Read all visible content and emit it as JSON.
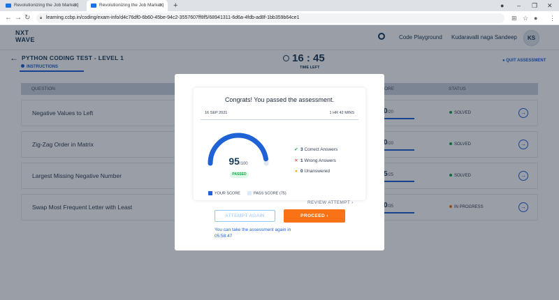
{
  "browser": {
    "tabs": [
      {
        "title": "Revolutionizing the Job Market |"
      },
      {
        "title": "Revolutionizing the Job Market |"
      }
    ],
    "new_tab": "+",
    "url": "learning.ccbp.in/coding/exam-info/d4c76df0-6b60-45be-94c2-3557607ff8f5/68941311-6d6a-4fdb-ad8f-1bb359b64ce1",
    "window_controls": {
      "minimize": "–",
      "restore": "❐",
      "close": "✕"
    }
  },
  "header": {
    "logo_line1": "NXT",
    "logo_line2": "WAVE",
    "code_playground": "Code Playground",
    "user_name": "Kudaravalli naga Sandeep",
    "avatar_initials": "KS"
  },
  "subheader": {
    "back_glyph": "←",
    "title": "PYTHON CODING TEST - LEVEL 1",
    "instructions": "INSTRUCTIONS",
    "time_value": "16 : 45",
    "time_label": "TIME LEFT",
    "quit": "QUIT ASSESSMENT"
  },
  "table": {
    "headers": {
      "question": "QUESTION",
      "score": "ORE",
      "status": "STATUS"
    },
    "rows": [
      {
        "name": "Negative Values to Left",
        "score": "0",
        "max": "/20",
        "status": "SOLVED",
        "status_color": "#16a34a"
      },
      {
        "name": "Zig-Zag Order in Matrix",
        "score": "0",
        "max": "/20",
        "status": "SOLVED",
        "status_color": "#16a34a"
      },
      {
        "name": "Largest Missing Negative Number",
        "score": "5",
        "max": "/25",
        "status": "SOLVED",
        "status_color": "#16a34a"
      },
      {
        "name": "Swap Most Frequent Letter with Least",
        "score": "0",
        "max": "/35",
        "status": "IN PROGRESS",
        "status_color": "#f97316"
      }
    ]
  },
  "modal": {
    "title": "Congrats! You passed the assessment.",
    "date": "16 SEP 2021",
    "duration": "1 HR 42 MINS",
    "score": "95",
    "score_max": "/100",
    "score_fraction": 0.95,
    "pass_fraction": 0.75,
    "badge": "PASSED",
    "stats": [
      {
        "icon": "check-icon",
        "glyph": "✔",
        "color": "#16a34a",
        "count": "3",
        "label": "Correct Answers"
      },
      {
        "icon": "cross-icon",
        "glyph": "✕",
        "color": "#dc2626",
        "count": "1",
        "label": "Wrong Answers"
      },
      {
        "icon": "dot-icon",
        "glyph": "●",
        "color": "#eab308",
        "count": "0",
        "label": "Unanswered"
      }
    ],
    "legend_your_score": "YOUR SCORE",
    "legend_pass_score": "PASS SCORE (75)",
    "review": "REVIEW ATTEMPT",
    "attempt_again": "ATTEMPT AGAIN",
    "proceed": "PROCEED",
    "retake_note": "You can take the assessment again in 05:58:47"
  },
  "colors": {
    "accent": "#1e62d6",
    "proceed": "#f97316",
    "passed": "#16a34a",
    "navy": "#183b56"
  }
}
